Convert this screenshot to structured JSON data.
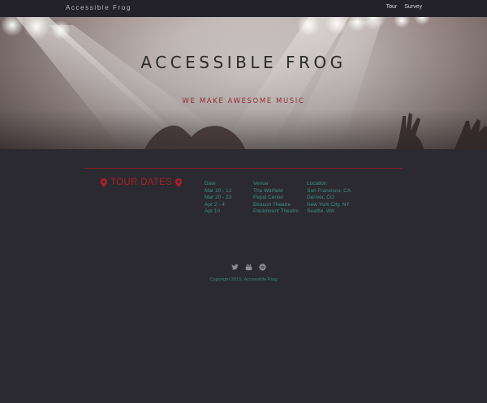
{
  "navbar": {
    "brand": "Accessible Frog",
    "links": [
      "Tour",
      "Survey"
    ]
  },
  "hero": {
    "title": "ACCESSIBLE FROG",
    "subtitle": "WE MAKE AWESOME MUSIC"
  },
  "tour": {
    "heading": "TOUR DATES",
    "columns": [
      "Date",
      "Venue",
      "Location"
    ],
    "rows": [
      [
        "Mar 10 - 12",
        "The Warfield",
        "San Francisco, CA"
      ],
      [
        "Mar 20 - 23",
        "Pepsi Center",
        "Denver, CO"
      ],
      [
        "Apr 2 - 4",
        "Beacon Theatre",
        "New York City, NY"
      ],
      [
        "Apr 10",
        "Paramount Theatre",
        "Seattle, WA"
      ]
    ]
  },
  "footer": {
    "social_icons": [
      "twitter-icon",
      "youtube-icon",
      "spotify-icon"
    ],
    "copyright": "Copyright 2015, Accessible Frog"
  },
  "colors": {
    "background": "#2b2a30",
    "accent": "#8d1e26",
    "teal": "#3f8f8c"
  }
}
